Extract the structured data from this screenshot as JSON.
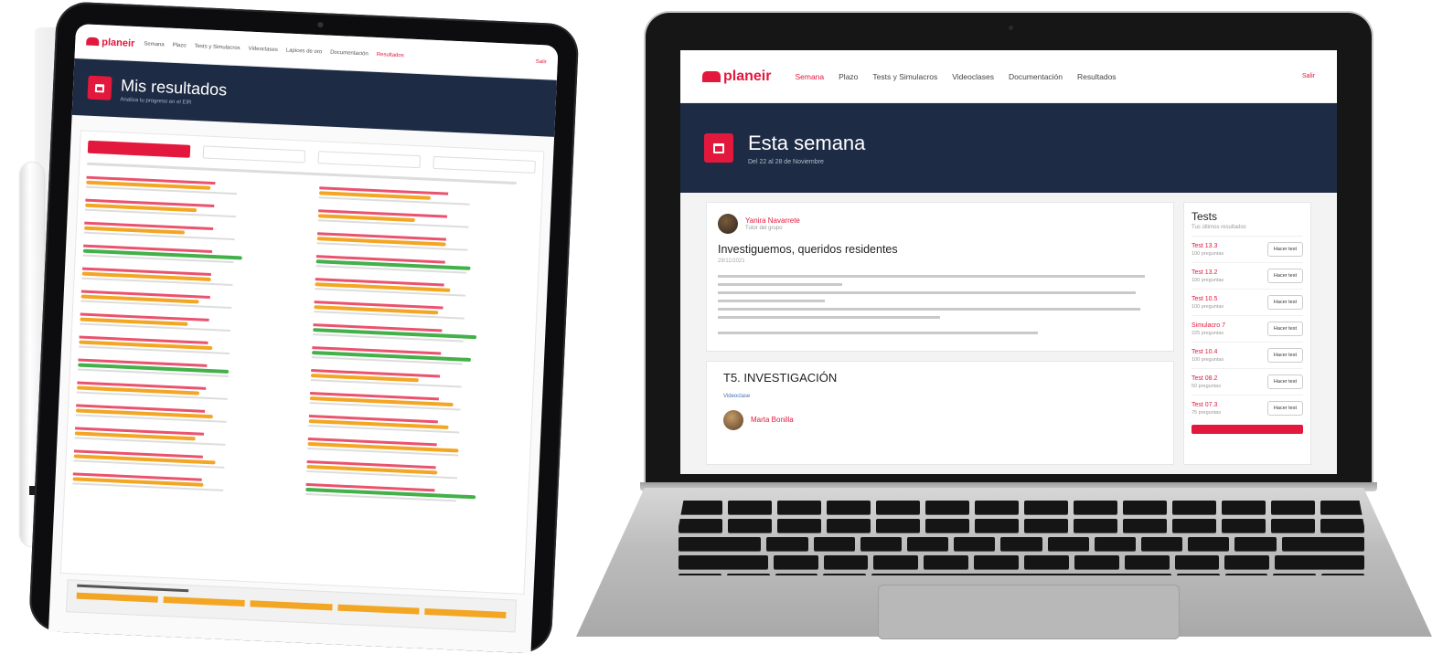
{
  "tablet": {
    "logo": "planeir",
    "nav": [
      "Semana",
      "Plazo",
      "Tests y Simulacros",
      "Videoclases",
      "Lapices de oro",
      "Documentación",
      "Resultados"
    ],
    "logout": "Salir",
    "page_title": "Mis resultados",
    "page_subtitle": "Analiza tu progreso en el EIR",
    "colors": {
      "accent": "#e3183d",
      "banner": "#1d2b45",
      "bar_orange": "#f2a623",
      "bar_green": "#43b04a"
    },
    "left_results": [
      {
        "level": 0.58,
        "status": "orange"
      },
      {
        "level": 0.52,
        "status": "orange"
      },
      {
        "level": 0.47,
        "status": "orange"
      },
      {
        "level": 0.74,
        "status": "green"
      },
      {
        "level": 0.6,
        "status": "orange"
      },
      {
        "level": 0.55,
        "status": "orange"
      },
      {
        "level": 0.5,
        "status": "orange"
      },
      {
        "level": 0.62,
        "status": "orange"
      },
      {
        "level": 0.7,
        "status": "green"
      },
      {
        "level": 0.57,
        "status": "orange"
      },
      {
        "level": 0.64,
        "status": "orange"
      },
      {
        "level": 0.56,
        "status": "orange"
      },
      {
        "level": 0.66,
        "status": "orange"
      },
      {
        "level": 0.61,
        "status": "orange"
      }
    ],
    "right_results": [
      {
        "level": 0.52,
        "status": "orange"
      },
      {
        "level": 0.45,
        "status": "orange"
      },
      {
        "level": 0.6,
        "status": "orange"
      },
      {
        "level": 0.72,
        "status": "green"
      },
      {
        "level": 0.63,
        "status": "orange"
      },
      {
        "level": 0.58,
        "status": "orange"
      },
      {
        "level": 0.76,
        "status": "green"
      },
      {
        "level": 0.74,
        "status": "green"
      },
      {
        "level": 0.5,
        "status": "orange"
      },
      {
        "level": 0.67,
        "status": "orange"
      },
      {
        "level": 0.65,
        "status": "orange"
      },
      {
        "level": 0.7,
        "status": "orange"
      },
      {
        "level": 0.61,
        "status": "orange"
      },
      {
        "level": 0.79,
        "status": "green"
      }
    ]
  },
  "laptop": {
    "logo": "planeir",
    "nav": [
      "Semana",
      "Plazo",
      "Tests y Simulacros",
      "Videoclases",
      "Documentación",
      "Resultados"
    ],
    "logout": "Salir",
    "page_title": "Esta semana",
    "page_subtitle": "Del 22 al 28 de Noviembre",
    "post": {
      "author": "Yanira Navarrete",
      "role": "Tutor del grupo",
      "title": "Investiguemos, queridos residentes",
      "date": "29/11/2021"
    },
    "topic": {
      "title": "T5. INVESTIGACIÓN",
      "meta": "Videoclase",
      "author": "Marta Bonilla"
    },
    "sidebar": {
      "title": "Tests",
      "subtitle": "Tus últimos resultados",
      "tests": [
        {
          "name": "Test 13.3",
          "questions": "100 preguntas"
        },
        {
          "name": "Test 13.2",
          "questions": "100 preguntas"
        },
        {
          "name": "Test 10.5",
          "questions": "100 preguntas"
        },
        {
          "name": "Simulacro 7",
          "questions": "225 preguntas"
        },
        {
          "name": "Test 10.4",
          "questions": "100 preguntas"
        },
        {
          "name": "Test 08.2",
          "questions": "50 preguntas"
        },
        {
          "name": "Test 07.3",
          "questions": "75 preguntas"
        }
      ],
      "button_label": "Hacer test"
    }
  }
}
